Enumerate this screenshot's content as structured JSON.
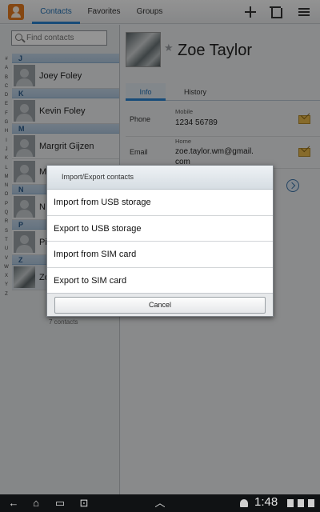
{
  "topbar": {
    "tabs": [
      {
        "label": "Contacts",
        "active": true
      },
      {
        "label": "Favorites",
        "active": false
      },
      {
        "label": "Groups",
        "active": false
      }
    ],
    "icons": [
      "add-contact-icon",
      "delete-icon",
      "menu-icon"
    ]
  },
  "search": {
    "placeholder": "Find contacts"
  },
  "index_letters": [
    "#",
    "A",
    "B",
    "C",
    "D",
    "E",
    "F",
    "G",
    "H",
    "I",
    "J",
    "K",
    "L",
    "M",
    "N",
    "O",
    "P",
    "Q",
    "R",
    "S",
    "T",
    "U",
    "V",
    "W",
    "X",
    "Y",
    "Z"
  ],
  "contact_list": {
    "sections": [
      {
        "letter": "J",
        "contacts": [
          "Joey Foley"
        ]
      },
      {
        "letter": "K",
        "contacts": [
          "Kevin Foley"
        ]
      },
      {
        "letter": "M",
        "contacts": [
          "Margrit Gijzen",
          "M"
        ]
      },
      {
        "letter": "N",
        "contacts": [
          "N"
        ]
      },
      {
        "letter": "P",
        "contacts": [
          "Pi"
        ]
      },
      {
        "letter": "Z",
        "contacts": [
          "Zo"
        ]
      }
    ],
    "count": "7 contacts"
  },
  "detail": {
    "name": "Zoe Taylor",
    "tabs": {
      "info": "Info",
      "history": "History"
    },
    "phone": {
      "label": "Phone",
      "type": "Mobile",
      "value": "1234 56789"
    },
    "email": {
      "label": "Email",
      "type": "Home",
      "value": "zoe.taylor.wm@gmail.",
      "value2": "com"
    }
  },
  "dialog": {
    "title": "Import/Export contacts",
    "items": [
      "Import from USB storage",
      "Export to USB storage",
      "Import from SIM card",
      "Export to SIM card"
    ],
    "cancel": "Cancel"
  },
  "sysbar": {
    "time": "1:48"
  }
}
